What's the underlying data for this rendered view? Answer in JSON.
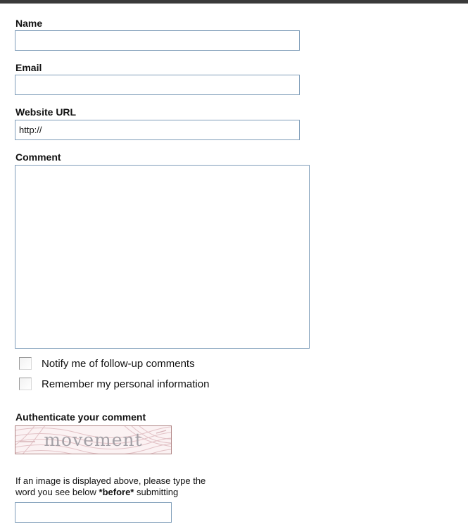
{
  "form": {
    "name_label": "Name",
    "name_value": "",
    "email_label": "Email",
    "email_value": "",
    "website_label": "Website URL",
    "website_value": "http://",
    "comment_label": "Comment",
    "comment_value": "",
    "notify_label": "Notify me of follow-up comments",
    "remember_label": "Remember my personal information",
    "auth_label": "Authenticate your comment",
    "captcha_word": "movement",
    "captcha_info_line1": "If an image is displayed above, please type the",
    "captcha_info_line2_pre": "word you see below ",
    "captcha_info_emphasis": "*before*",
    "captcha_info_line2_post": " submitting",
    "captcha_value": ""
  },
  "colors": {
    "field_border": "#7f9db9",
    "top_border": "#3a3a3a",
    "captcha_background": "#fbf2f3",
    "captcha_text": "#a3a0a6"
  }
}
